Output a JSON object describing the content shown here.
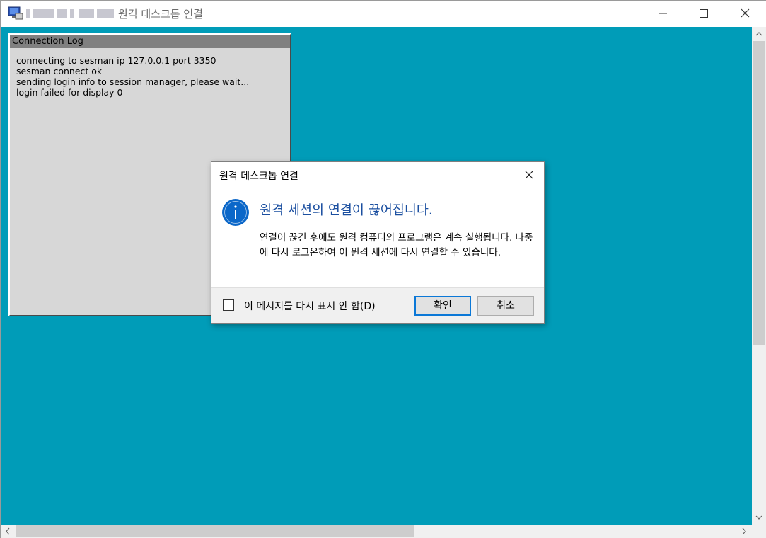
{
  "window": {
    "title": "원격 데스크톱 연결",
    "icon": "remote-desktop-icon",
    "controls": [
      "minimize-icon",
      "maximize-icon",
      "close-icon"
    ]
  },
  "remote_session": {
    "background_color": "#009cb8",
    "connection_log": {
      "title": "Connection Log",
      "lines": [
        "connecting to sesman ip 127.0.0.1 port 3350",
        "sesman connect ok",
        "sending login info to session manager, please wait...",
        "login failed for display 0"
      ]
    }
  },
  "dialog": {
    "title": "원격 데스크톱 연결",
    "icon": "info-icon",
    "heading": "원격 세션의 연결이 끊어집니다.",
    "body": "연결이 끊긴 후에도 원격 컴퓨터의 프로그램은 계속 실행됩니다. 나중에 다시 로그온하여 이 원격 세션에 다시 연결할 수 있습니다.",
    "checkbox_label": "이 메시지를 다시 표시 안 함(D)",
    "checkbox_checked": false,
    "ok_label": "확인",
    "cancel_label": "취소"
  },
  "colors": {
    "accent": "#0b78d7",
    "heading": "#1b4fa0",
    "info_icon": "#0b67c9"
  }
}
